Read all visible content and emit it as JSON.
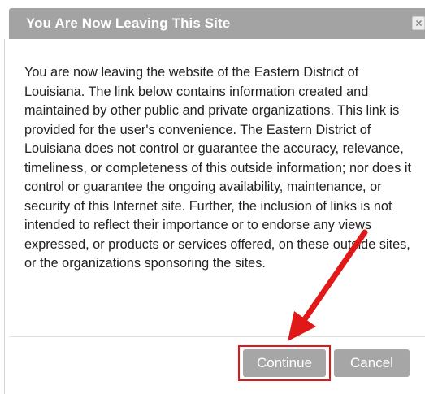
{
  "dialog": {
    "title": "You Are Now Leaving This Site",
    "close_label": "×",
    "body": "You are now leaving the website of the Eastern District of Louisiana. The link below contains information created and maintained by other public and private organizations. This link is provided for the user's convenience. The Eastern District of Louisiana does not control or guarantee the accuracy, relevance, timeliness, or completeness of this outside information; nor does it control or guarantee the ongoing availability, maintenance, or security of this Internet site. Further, the inclusion of links is not intended to reflect their importance or to endorse any views expressed, or products or services offered, on these outside sites, or the organizations sponsoring the sites.",
    "buttons": {
      "continue_label": "Continue",
      "cancel_label": "Cancel"
    }
  },
  "annotation": {
    "arrow_color": "#e01818",
    "highlight_color": "#e01818"
  },
  "colors": {
    "titlebar": "#a3a3a3",
    "button": "#a6a6a6"
  }
}
